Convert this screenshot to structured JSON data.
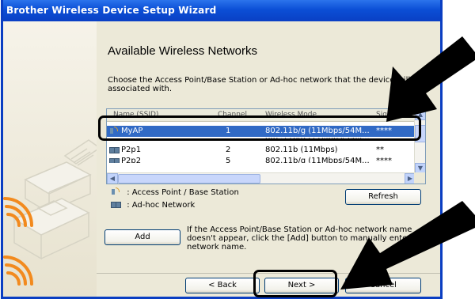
{
  "window": {
    "title": "Brother Wireless Device Setup Wizard"
  },
  "page": {
    "heading": "Available Wireless Networks",
    "description": "Choose the Access Point/Base Station or Ad-hoc network that the device will be associated with."
  },
  "networks": {
    "rows": [
      {
        "name": "MyAP",
        "channel": "1",
        "mode": "802.11b/g (11Mbps/54M...",
        "signal": "****",
        "type_icon": "access-point-icon",
        "selected": true
      },
      {
        "name": "P2p1",
        "channel": "2",
        "mode": "802.11b (11Mbps)",
        "signal": "**",
        "type_icon": "ad-hoc-icon",
        "selected": false
      },
      {
        "name": "P2p2",
        "channel": "5",
        "mode": "802.11b/g (11Mbps/54M...",
        "signal": "****",
        "type_icon": "ad-hoc-icon",
        "selected": false
      }
    ]
  },
  "legend": {
    "access_point": ": Access Point / Base Station",
    "ad_hoc": ": Ad-hoc Network"
  },
  "buttons": {
    "refresh": "Refresh",
    "add": "Add",
    "back": "< Back",
    "next": "Next >",
    "cancel": "Cancel"
  },
  "info_text": "If the Access Point/Base Station or Ad-hoc network name doesn't appear, click the [Add] button to manually enter the network name.",
  "colors": {
    "titlebar": "#0b4fd6",
    "selection": "#316ac5",
    "callout": "#000000"
  }
}
